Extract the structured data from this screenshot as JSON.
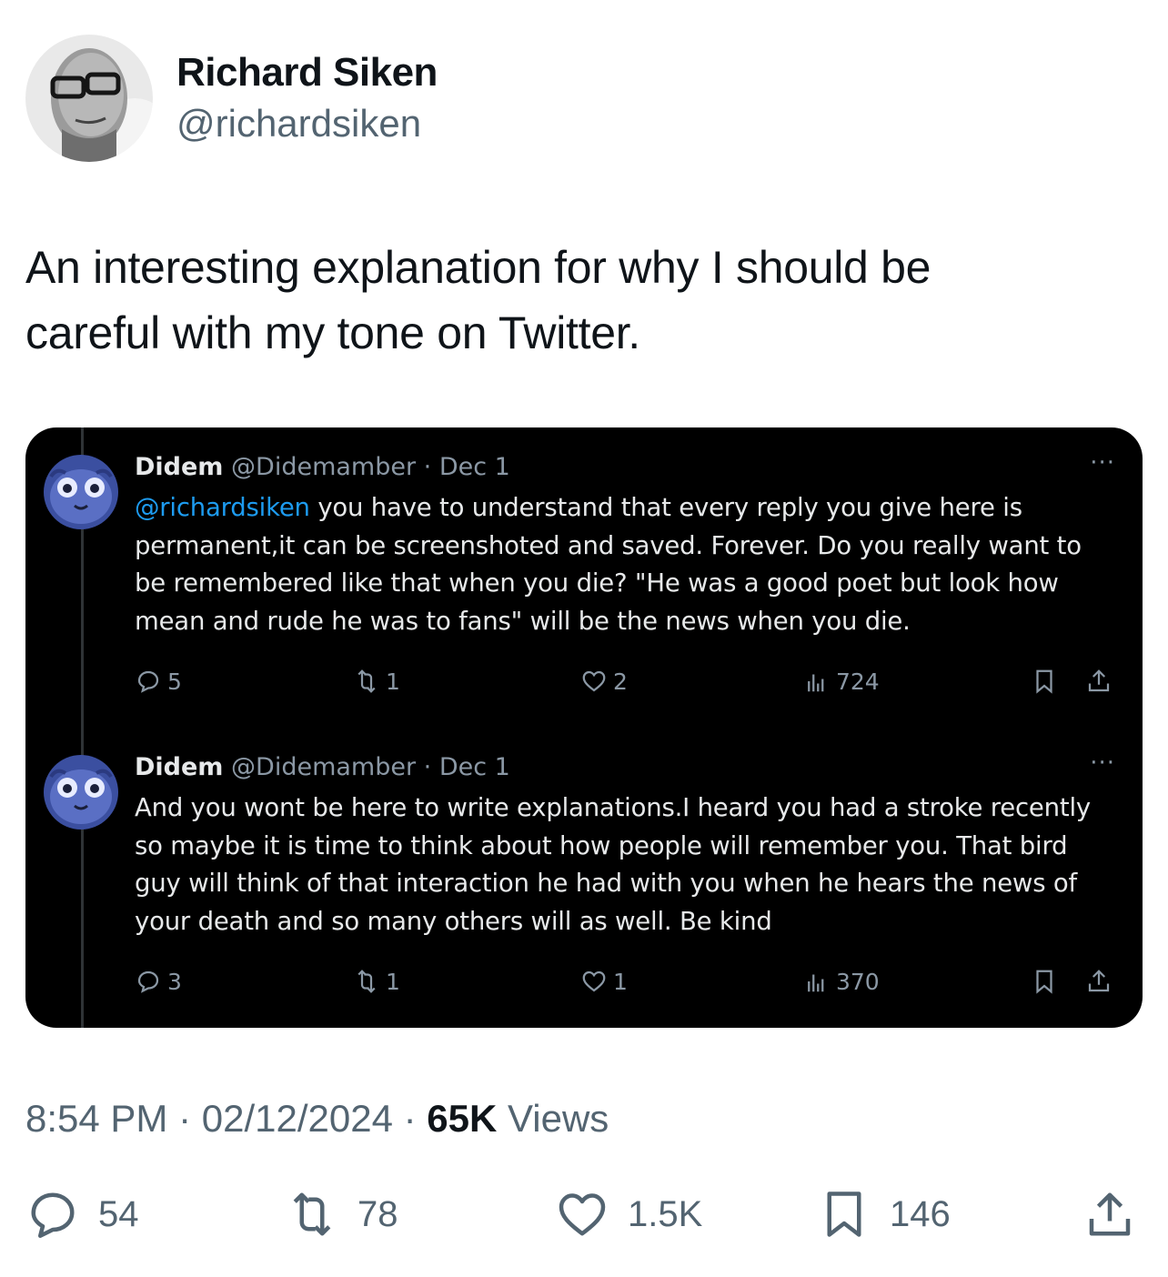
{
  "author": {
    "display_name": "Richard Siken",
    "handle": "@richardsiken"
  },
  "tweet": {
    "text_line1": "An interesting explanation for why I should be",
    "text_line2": "careful with my tone on Twitter."
  },
  "quoted_replies": [
    {
      "name": "Didem",
      "handle_date": "@Didemamber · Dec 1",
      "mention": "@richardsiken",
      "text": " you have to understand that every reply you give here is permanent,it can be screenshoted and saved. Forever. Do you really want to be remembered like that when you die? \"He was a good poet but look how mean and rude he was to fans\" will be the news when you die.",
      "replies": "5",
      "reposts": "1",
      "likes": "2",
      "views": "724",
      "more": "···"
    },
    {
      "name": "Didem",
      "handle_date": "@Didemamber · Dec 1",
      "mention": "",
      "text": "And you wont be here to write explanations.I heard you had a stroke recently so maybe it is time to think about how people will remember you. That bird guy will think of that interaction he had with you when he hears the news of your death and so many others will as well. Be kind",
      "replies": "3",
      "reposts": "1",
      "likes": "1",
      "views": "370",
      "more": "···"
    }
  ],
  "meta": {
    "time_date": "8:54 PM · 02/12/2024 · ",
    "views_count": "65K",
    "views_label": " Views"
  },
  "stats": {
    "replies": "54",
    "reposts": "78",
    "likes": "1.5K",
    "bookmarks": "146"
  },
  "colors": {
    "link": "#1d9bf0",
    "secondary_text": "#536471",
    "dark_card": "#000000"
  }
}
